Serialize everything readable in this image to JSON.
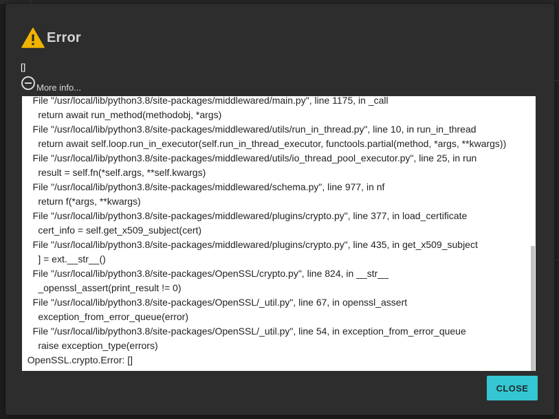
{
  "dialog": {
    "title": "Error",
    "message": "[]",
    "more_info_label": "More info...",
    "close_label": "CLOSE",
    "accent_color": "#35c6d3",
    "warning_color": "#f0b400"
  },
  "traceback": [
    "    File \"/usr/local/lib/python3.8/site-packages/middlewared/main.py\", line 1175, in _call",
    "      return await run_method(methodobj, *args)",
    "    File \"/usr/local/lib/python3.8/site-packages/middlewared/utils/run_in_thread.py\", line 10, in run_in_thread",
    "      return await self.loop.run_in_executor(self.run_in_thread_executor, functools.partial(method, *args, **kwargs))",
    "    File \"/usr/local/lib/python3.8/site-packages/middlewared/utils/io_thread_pool_executor.py\", line 25, in run",
    "      result = self.fn(*self.args, **self.kwargs)",
    "    File \"/usr/local/lib/python3.8/site-packages/middlewared/schema.py\", line 977, in nf",
    "      return f(*args, **kwargs)",
    "    File \"/usr/local/lib/python3.8/site-packages/middlewared/plugins/crypto.py\", line 377, in load_certificate",
    "      cert_info = self.get_x509_subject(cert)",
    "    File \"/usr/local/lib/python3.8/site-packages/middlewared/plugins/crypto.py\", line 435, in get_x509_subject",
    "      ] = ext.__str__()",
    "    File \"/usr/local/lib/python3.8/site-packages/OpenSSL/crypto.py\", line 824, in __str__",
    "      _openssl_assert(print_result != 0)",
    "    File \"/usr/local/lib/python3.8/site-packages/OpenSSL/_util.py\", line 67, in openssl_assert",
    "      exception_from_error_queue(error)",
    "    File \"/usr/local/lib/python3.8/site-packages/OpenSSL/_util.py\", line 54, in exception_from_error_queue",
    "      raise exception_type(errors)",
    "  OpenSSL.crypto.Error: []"
  ]
}
